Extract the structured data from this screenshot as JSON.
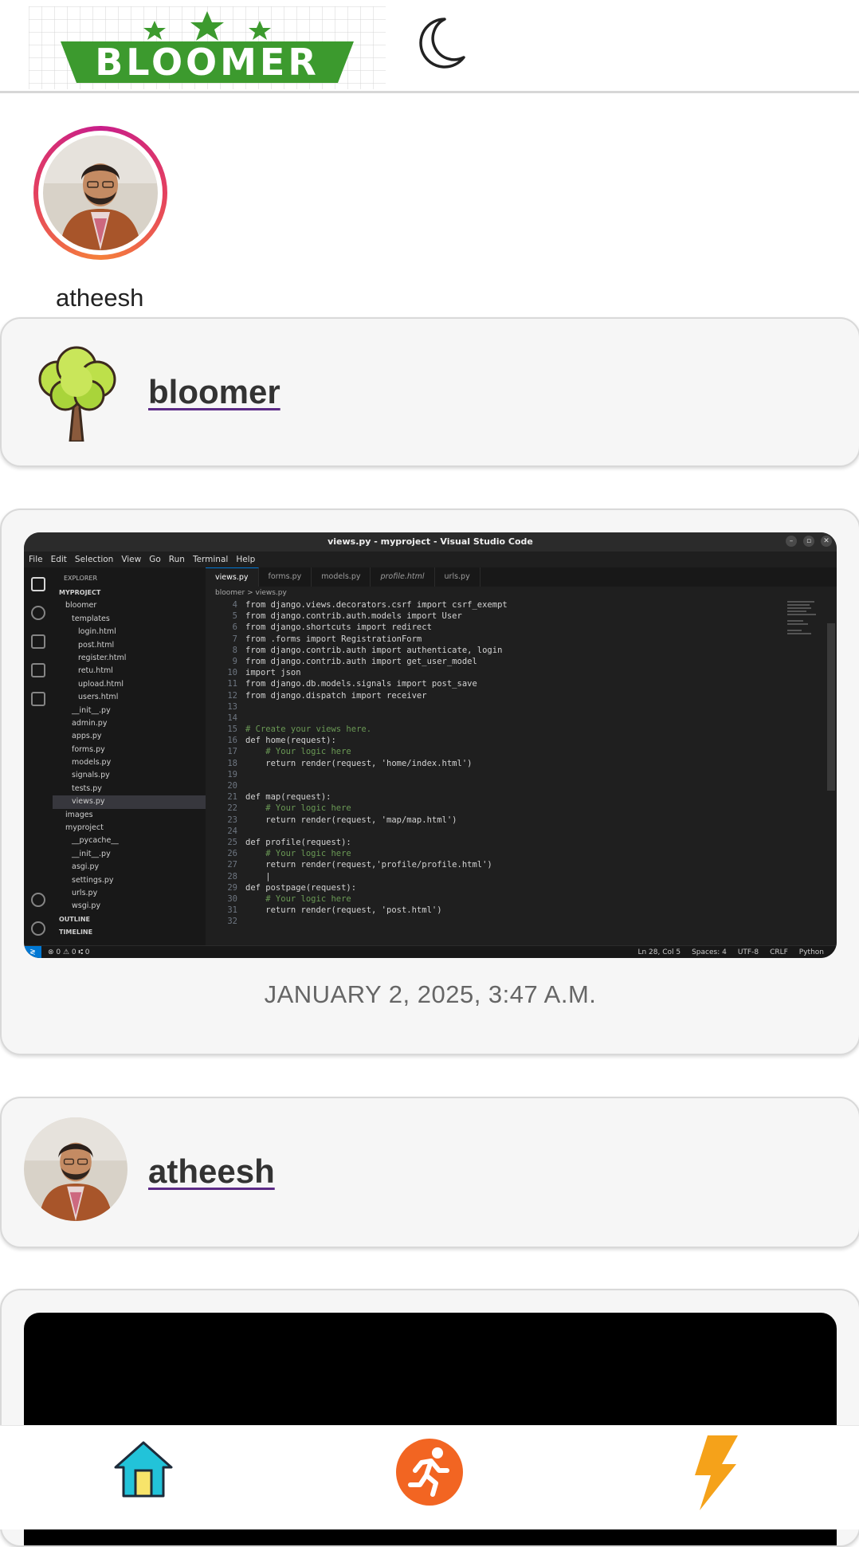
{
  "header": {
    "logo_text": "BLOOMER",
    "theme_icon": "moon-icon"
  },
  "profile": {
    "username": "atheesh"
  },
  "posts": [
    {
      "author": "bloomer",
      "avatar_icon": "tree-icon"
    },
    {
      "date": "JANUARY 2, 2025, 3:47 A.M.",
      "screenshot": {
        "window_title": "views.py - myproject - Visual Studio Code",
        "menu": [
          "File",
          "Edit",
          "Selection",
          "View",
          "Go",
          "Run",
          "Terminal",
          "Help"
        ],
        "explorer_title": "EXPLORER",
        "explorer_items": [
          "MYPROJECT",
          "bloomer",
          "templates",
          "login.html",
          "post.html",
          "register.html",
          "retu.html",
          "upload.html",
          "users.html",
          "__init__.py",
          "admin.py",
          "apps.py",
          "forms.py",
          "models.py",
          "signals.py",
          "tests.py",
          "views.py",
          "images",
          "myproject",
          "__pycache__",
          "__init__.py",
          "asgi.py",
          "settings.py",
          "urls.py",
          "wsgi.py",
          "OUTLINE",
          "TIMELINE"
        ],
        "tabs": [
          "views.py",
          "forms.py",
          "models.py",
          "profile.html",
          "urls.py"
        ],
        "breadcrumb": "bloomer > views.py",
        "line_numbers": [
          "4",
          "5",
          "6",
          "7",
          "8",
          "9",
          "10",
          "11",
          "12",
          "13",
          "14",
          "15",
          "16",
          "17",
          "18",
          "19",
          "20",
          "21",
          "22",
          "23",
          "24",
          "25",
          "26",
          "27",
          "28",
          "29",
          "30",
          "31",
          "32"
        ],
        "code_lines": [
          "from django.views.decorators.csrf import csrf_exempt",
          "from django.contrib.auth.models import User",
          "from django.shortcuts import redirect",
          "from .forms import RegistrationForm",
          "from django.contrib.auth import authenticate, login",
          "from django.contrib.auth import get_user_model",
          "import json",
          "from django.db.models.signals import post_save",
          "from django.dispatch import receiver",
          "",
          "",
          "# Create your views here.",
          "def home(request):",
          "    # Your logic here",
          "    return render(request, 'home/index.html')",
          "",
          "",
          "def map(request):",
          "    # Your logic here",
          "    return render(request, 'map/map.html')",
          "",
          "def profile(request):",
          "    # Your logic here",
          "    return render(request,'profile/profile.html')",
          "    |",
          "def postpage(request):",
          "    # Your logic here",
          "    return render(request, 'post.html')",
          ""
        ],
        "status_left": "⊗ 0 ⚠ 0   ⑆ 0",
        "status_right": [
          "Ln 28, Col 5",
          "Spaces: 4",
          "UTF-8",
          "CRLF",
          "Python"
        ]
      }
    },
    {
      "author": "atheesh"
    }
  ],
  "bottom_nav": {
    "items": [
      "home-icon",
      "running-icon",
      "lightning-icon"
    ]
  },
  "colors": {
    "logo_green": "#3c9a2e",
    "ring_start": "#c81e8a",
    "ring_end": "#f5803a",
    "link_underline": "#5b2a86",
    "home_blue": "#22c3d9",
    "run_orange": "#f26522",
    "bolt_orange": "#f5a21a"
  }
}
